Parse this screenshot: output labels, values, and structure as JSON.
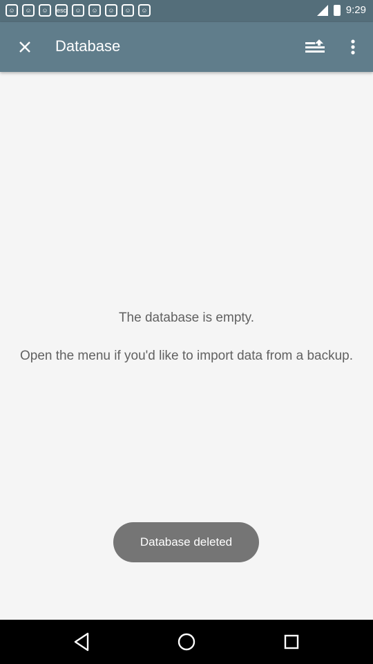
{
  "status_bar": {
    "time": "9:29",
    "notification_icons": [
      "☺",
      "☺",
      "☺",
      "esc",
      "☺",
      "☺",
      "☺",
      "☺",
      "☺"
    ]
  },
  "app_bar": {
    "title": "Database",
    "icons": [
      "close-icon",
      "import-icon",
      "more-vertical-icon"
    ]
  },
  "empty_state": {
    "line1": "The database is empty.",
    "line2": "Open the menu if you'd like to import data from a backup."
  },
  "toast": {
    "text": "Database deleted"
  },
  "nav": {
    "icons": [
      "back-icon",
      "home-icon",
      "recents-icon"
    ]
  },
  "colors": {
    "app_bar": "#607d8b",
    "status_bar": "#546e7a",
    "toast": "#757575",
    "text": "#616161"
  }
}
